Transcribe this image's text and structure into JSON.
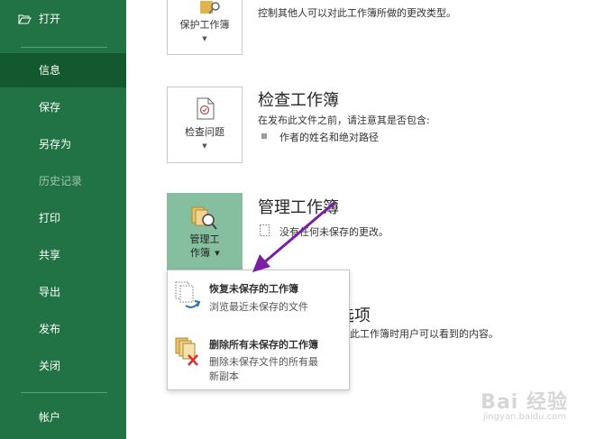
{
  "sidebar": {
    "open": "打开",
    "items": [
      {
        "label": "信息"
      },
      {
        "label": "保存"
      },
      {
        "label": "另存为"
      },
      {
        "label": "历史记录"
      },
      {
        "label": "打印"
      },
      {
        "label": "共享"
      },
      {
        "label": "导出"
      },
      {
        "label": "发布"
      },
      {
        "label": "关闭"
      }
    ],
    "account": "帐户"
  },
  "protect": {
    "button_line1": "保护工作簿",
    "description": "控制其他人可以对此工作簿所做的更改类型。"
  },
  "inspect": {
    "title": "检查工作簿",
    "button_label": "检查问题",
    "description": "在发布此文件之前，请注意其是否包含:",
    "bullet": "作者的姓名和绝对路径"
  },
  "manage": {
    "title": "管理工作簿",
    "button_line1": "管理工",
    "button_line2": "作簿",
    "description": "没有任何未保存的更改。"
  },
  "browser_view": {
    "title_partial": "选项",
    "description_partial": "此工作簿时用户可以看到的内容。"
  },
  "dropdown": {
    "recover": {
      "title": "恢复未保存的工作簿",
      "desc": "浏览最近未保存的文件"
    },
    "delete": {
      "title": "删除所有未保存的工作簿",
      "desc_line1": "删除未保存文件的所有最",
      "desc_line2": "新副本"
    }
  },
  "watermark": {
    "main": "Bai  经验",
    "sub": "jingyan.baidu.com"
  },
  "colors": {
    "sidebar": "#217346",
    "sidebar_active": "#12592f",
    "manage_button": "#86bf9f",
    "arrow": "#7b1fa2"
  }
}
